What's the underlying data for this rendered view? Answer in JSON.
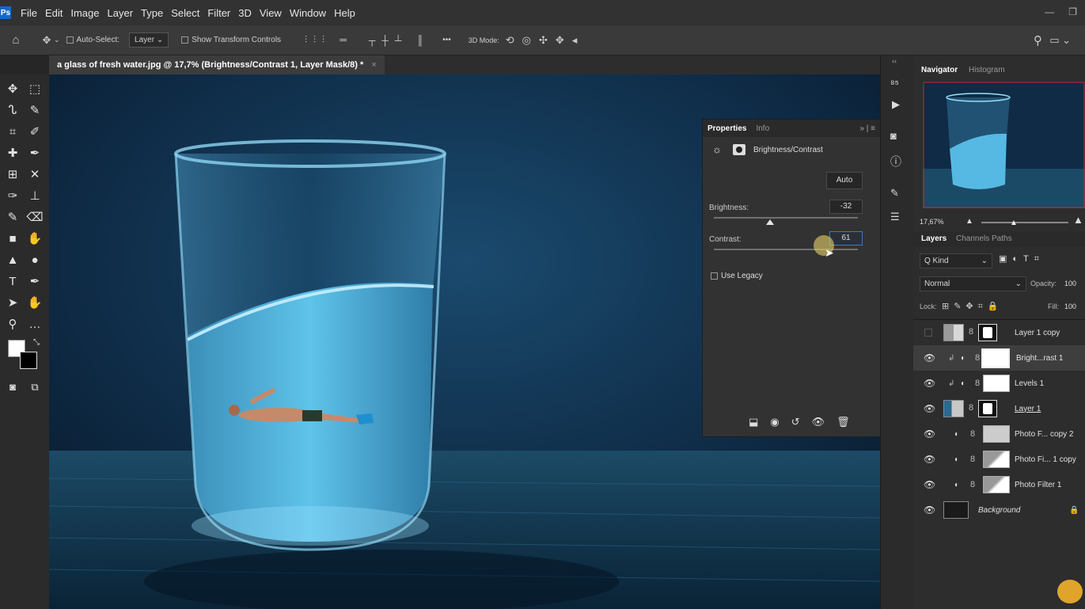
{
  "menu": [
    "File",
    "Edit",
    "Image",
    "Layer",
    "Type",
    "Select",
    "Filter",
    "3D",
    "View",
    "Window",
    "Help"
  ],
  "options": {
    "auto_select": "Auto-Select:",
    "layer_dd": "Layer",
    "show_transform": "Show Transform Controls",
    "mode_3d": "3D Mode:",
    "more": "•••"
  },
  "document_tab": "a glass of fresh water.jpg @ 17,7% (Brightness/Contrast 1, Layer Mask/8) *",
  "properties": {
    "tab_props": "Properties",
    "tab_info": "Info",
    "adj_title": "Brightness/Contrast",
    "auto": "Auto",
    "brightness_label": "Brightness:",
    "brightness_value": "-32",
    "contrast_label": "Contrast:",
    "contrast_value": "61",
    "use_legacy": "Use Legacy"
  },
  "navigator": {
    "tab_nav": "Navigator",
    "tab_hist": "Histogram",
    "zoom": "17,67%"
  },
  "layers_panel": {
    "tab_layers": "Layers",
    "tab_channels": "Channels",
    "tab_paths": "Paths",
    "kind": "Q Kind",
    "blend": "Normal",
    "opacity_label": "Opacity:",
    "opacity_value": "100",
    "lock_label": "Lock:",
    "fill_label": "Fill:",
    "fill_value": "100"
  },
  "layers": [
    {
      "name": "Layer 1 copy"
    },
    {
      "name": "Bright...rast 1"
    },
    {
      "name": "Levels 1"
    },
    {
      "name": "Layer 1"
    },
    {
      "name": "Photo F... copy 2"
    },
    {
      "name": "Photo Fi... 1 copy"
    },
    {
      "name": "Photo Filter 1"
    },
    {
      "name": "Background"
    }
  ]
}
